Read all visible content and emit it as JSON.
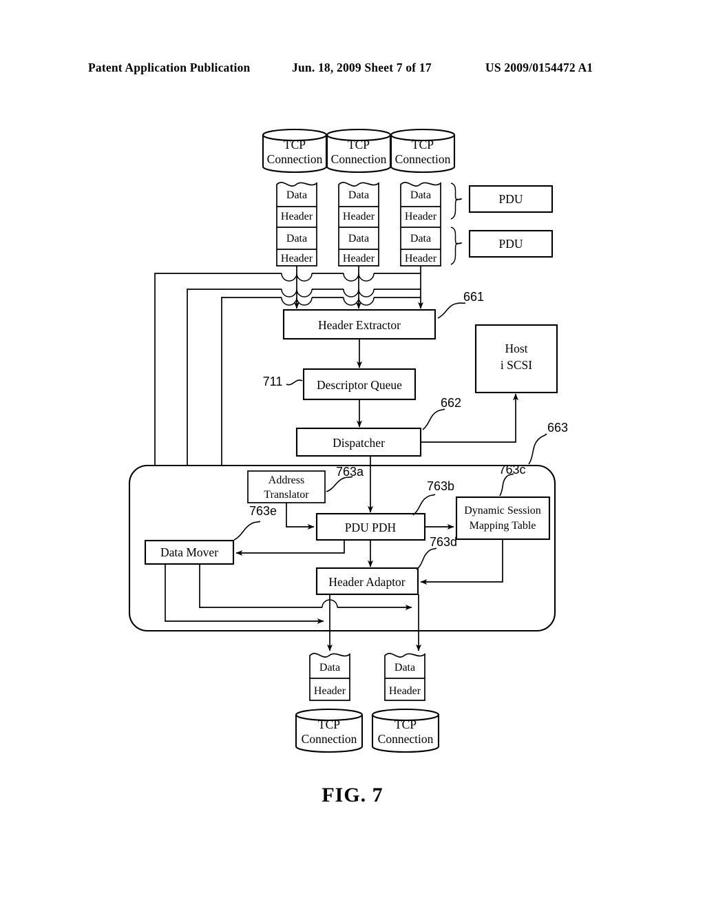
{
  "page": {
    "header_left": "Patent Application Publication",
    "header_mid": "Jun. 18, 2009  Sheet 7 of 17",
    "header_right": "US 2009/0154472 A1",
    "figure_caption": "FIG. 7"
  },
  "figure": {
    "top_connections": [
      {
        "label_line1": "TCP",
        "label_line2": "Connection"
      },
      {
        "label_line1": "TCP",
        "label_line2": "Connection"
      },
      {
        "label_line1": "TCP",
        "label_line2": "Connection"
      }
    ],
    "packet_stacks": [
      {
        "segments": [
          "Data",
          "Header",
          "Data",
          "Header"
        ]
      },
      {
        "segments": [
          "Data",
          "Header",
          "Data",
          "Header"
        ]
      },
      {
        "segments": [
          "Data",
          "Header",
          "Data",
          "Header"
        ]
      }
    ],
    "pdu_boxes": [
      {
        "label": "PDU"
      },
      {
        "label": "PDU"
      }
    ],
    "blocks": {
      "header_extractor": {
        "label": "Header Extractor",
        "ref": "661"
      },
      "descriptor_queue": {
        "label": "Descriptor Queue",
        "ref": "711"
      },
      "dispatcher": {
        "label": "Dispatcher",
        "ref": "662"
      },
      "host_iscsi": {
        "label_line1": "Host",
        "label_line2": "i SCSI"
      },
      "engine_group": {
        "ref": "663"
      },
      "address_translator": {
        "label_line1": "Address",
        "label_line2": "Translator"
      },
      "pdu_pdh": {
        "label": "PDU PDH",
        "ref_in": "763a",
        "ref_out": "763b"
      },
      "dynamic_session_mapping_table": {
        "label_line1": "Dynamic Session",
        "label_line2": "Mapping Table",
        "ref": "763c"
      },
      "header_adaptor": {
        "label": "Header Adaptor",
        "ref": "763d"
      },
      "data_mover": {
        "label": "Data Mover",
        "ref": "763e"
      }
    },
    "output_packets": [
      {
        "segments": [
          "Data",
          "Header"
        ]
      },
      {
        "segments": [
          "Data",
          "Header"
        ]
      }
    ],
    "bottom_connections": [
      {
        "label_line1": "TCP",
        "label_line2": "Connection"
      },
      {
        "label_line1": "TCP",
        "label_line2": "Connection"
      }
    ]
  }
}
